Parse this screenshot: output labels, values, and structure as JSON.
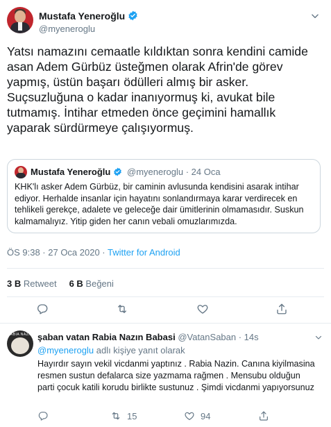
{
  "tweet": {
    "author": {
      "name": "Mustafa Yeneroğlu",
      "handle": "@myeneroglu",
      "verified": true
    },
    "text": "Yatsı namazını cemaatle kıldıktan sonra kendini camide\nasan Adem Gürbüz üsteğmen olarak Afrin'de görev\nyapmış, üstün başarı ödülleri almış bir asker.\nSuçsuzluğuna o kadar inanıyormuş ki, avukat bile\ntutmamış. İntihar etmeden önce geçimini hamallık\nyaparak sürdürmeye çalışıyormuş.",
    "quoted": {
      "name": "Mustafa Yeneroğlu",
      "meta": "@myeneroglu · 24 Oca",
      "text": "KHK'lı asker Adem Gürbüz, bir caminin avlusunda kendisini asarak intihar ediyor. Herhalde insanlar için hayatını sonlandırmaya karar verdirecek en tehlikeli gerekçe, adalete ve geleceğe dair ümitlerinin olmamasıdır. Suskun kalmamalıyız. Yitip giden her canın vebali omuzlarımızda."
    },
    "timestamp": "ÖS 9:38 · 27 Oca 2020 · ",
    "source": "Twitter for Android",
    "retweets_count": "3 B",
    "retweets_label": "Retweet",
    "likes_count": "6 B",
    "likes_label": "Beğeni"
  },
  "reply": {
    "name": "şaban vatan Rabia Nazın Babasi",
    "meta": "@VatanSaban · 14s",
    "avatar_text": "RABIA NAZIN",
    "mention": "@myeneroglu",
    "reply_suffix": " adlı kişiye yanıt olarak",
    "text": "Hayırdır sayın vekil vicdanmi yaptınız . Rabia Nazin. Canına kiyilmasina resmen sustun defalarca size yazmama rağmen . Mensubu olduğun parti çocuk katili korudu birlikte sustunuz . Şimdi vicdanmi yapıyorsunuz",
    "retweets": "15",
    "likes": "94"
  },
  "colors": {
    "accent": "#1da1f2",
    "secondary_text": "#657786",
    "border": "#e6ecf0"
  },
  "icons": [
    "verified-badge-icon",
    "chevron-down-icon",
    "reply-icon",
    "retweet-icon",
    "like-icon",
    "share-icon"
  ]
}
